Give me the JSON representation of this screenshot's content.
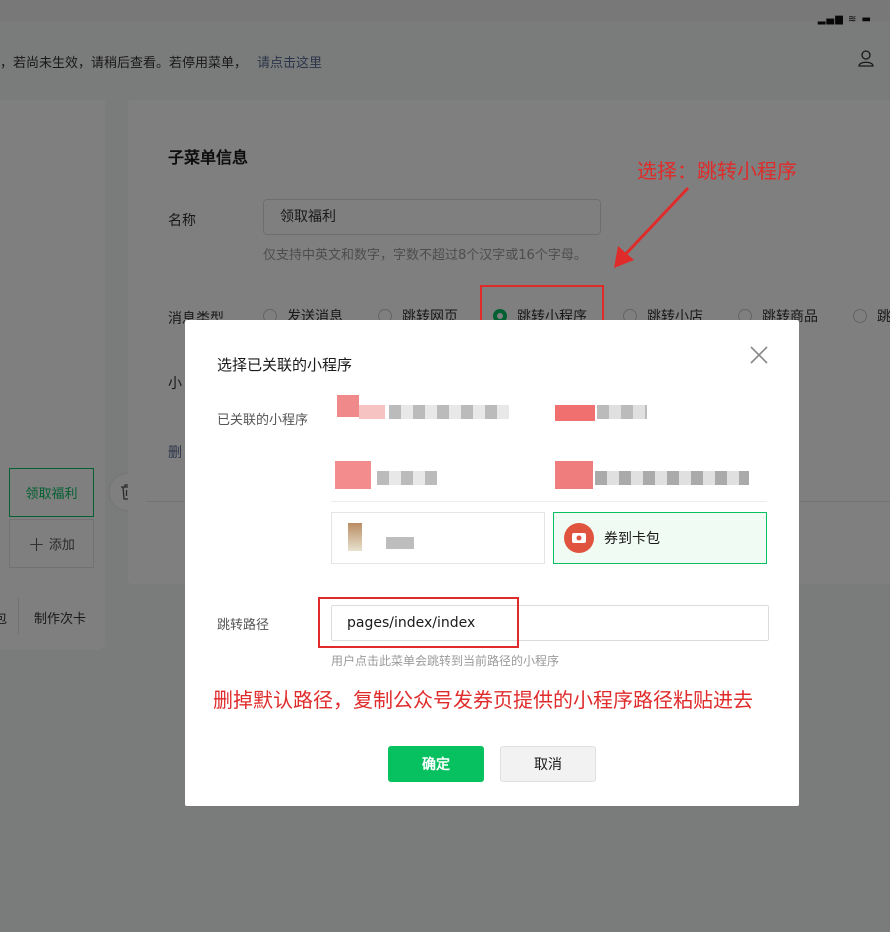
{
  "notice": {
    "text": "，若尚未生效，请稍后查看。若停用菜单，",
    "link": "请点击这里"
  },
  "phone": {
    "status": "▂▄▆ ≋ ▬",
    "menu_active": "领取福利",
    "menu_add": "添加",
    "bottom_items": [
      "包",
      "制作次卡"
    ]
  },
  "editor": {
    "title": "子菜单信息",
    "name_label": "名称",
    "name_value": "领取福利",
    "name_hint": "仅支持中英文和数字，字数不超过8个汉字或16个字母。",
    "type_label": "消息类型",
    "types": [
      {
        "label": "发送消息",
        "selected": false
      },
      {
        "label": "跳转网页",
        "selected": false
      },
      {
        "label": "跳转小程序",
        "selected": true
      },
      {
        "label": "跳转小店",
        "selected": false
      },
      {
        "label": "跳转商品",
        "selected": false
      },
      {
        "label": "跳",
        "selected": false
      }
    ],
    "mini_label": "小",
    "delete_label": "删"
  },
  "dialog": {
    "title": "选择已关联的小程序",
    "linked_label": "已关联的小程序",
    "selected_program": "券到卡包",
    "path_label": "跳转路径",
    "path_value": "pages/index/index",
    "path_hint": "用户点击此菜单会跳转到当前路径的小程序",
    "ok_label": "确定",
    "cancel_label": "取消"
  },
  "annotations": {
    "top": "选择：跳转小程序",
    "bottom": "删掉默认路径，复制公众号发券页提供的小程序路径粘贴进去"
  },
  "colors": {
    "brand_green": "#07c160",
    "annotation_red": "#e02b2b",
    "link_blue": "#576b95"
  }
}
